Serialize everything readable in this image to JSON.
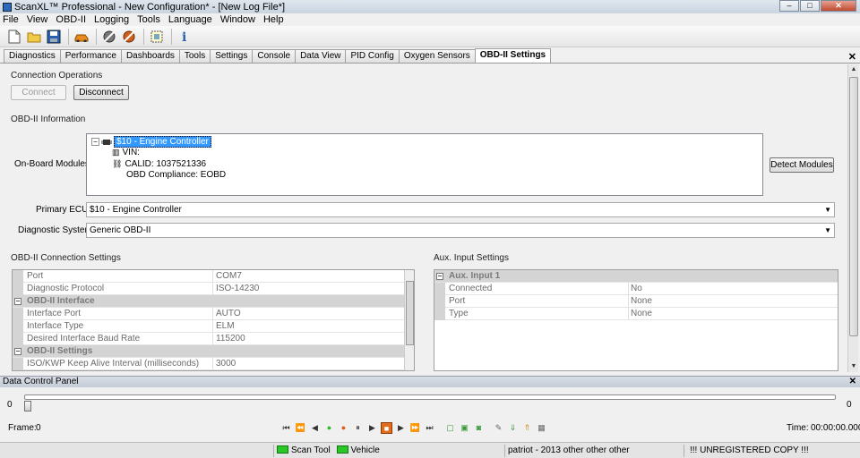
{
  "window": {
    "title": "ScanXL™ Professional - New Configuration* - [New Log File*]",
    "minimize": "–",
    "restore": "□",
    "close": "✕"
  },
  "menu": [
    "File",
    "View",
    "OBD-II",
    "Logging",
    "Tools",
    "Language",
    "Window",
    "Help"
  ],
  "toolbar": {
    "icons": [
      "new-file-icon",
      "open-folder-icon",
      "save-icon",
      "car-icon",
      "connect-icon",
      "disconnect-icon",
      "select-icon",
      "info-icon"
    ]
  },
  "tabs": [
    "Diagnostics",
    "Performance",
    "Dashboards",
    "Tools",
    "Settings",
    "Console",
    "Data View",
    "PID Config",
    "Oxygen Sensors",
    "OBD-II Settings"
  ],
  "active_tab": "OBD-II Settings",
  "connection": {
    "section_label": "Connection Operations",
    "connect_label": "Connect",
    "disconnect_label": "Disconnect"
  },
  "obd_info": {
    "section_label": "OBD-II Information",
    "onboard_label": "On-Board Modules:",
    "tree_root": "$10 - Engine Controller",
    "tree_children": [
      "VIN:",
      "CALID: 1037521336",
      "OBD Compliance: EOBD"
    ],
    "detect_label": "Detect Modules",
    "primary_ecu_label": "Primary ECU:",
    "primary_ecu_value": "$10 - Engine Controller",
    "diag_system_label": "Diagnostic System:",
    "diag_system_value": "Generic OBD-II"
  },
  "conn_settings": {
    "section_label": "OBD-II Connection Settings",
    "rows": [
      {
        "type": "prop",
        "key": "Port",
        "value": "COM7"
      },
      {
        "type": "prop",
        "key": "Diagnostic Protocol",
        "value": "ISO-14230"
      },
      {
        "type": "cat",
        "key": "OBD-II Interface"
      },
      {
        "type": "prop",
        "key": "Interface Port",
        "value": "AUTO"
      },
      {
        "type": "prop",
        "key": "Interface Type",
        "value": "ELM"
      },
      {
        "type": "prop",
        "key": "Desired Interface Baud Rate",
        "value": "115200"
      },
      {
        "type": "cat",
        "key": "OBD-II Settings"
      },
      {
        "type": "prop",
        "key": "ISO/KWP Keep Alive Interval (milliseconds)",
        "value": "3000"
      }
    ]
  },
  "aux_settings": {
    "section_label": "Aux. Input Settings",
    "rows": [
      {
        "type": "cat",
        "key": "Aux. Input 1"
      },
      {
        "type": "prop",
        "key": "Connected",
        "value": "No"
      },
      {
        "type": "prop",
        "key": "Port",
        "value": "None"
      },
      {
        "type": "prop",
        "key": "Type",
        "value": "None"
      }
    ]
  },
  "data_panel": {
    "title": "Data Control Panel",
    "close": "✕",
    "slider_min": "0",
    "slider_max": "0",
    "frame_label": "Frame:",
    "frame_value": "0",
    "time_label": "Time:",
    "time_value": "00:00:00.000"
  },
  "status": {
    "scan_tool": "Scan Tool",
    "vehicle": "Vehicle",
    "vehicle_name": "patriot - 2013 other other other",
    "registration": "!!! UNREGISTERED COPY !!!"
  },
  "colors": {
    "led_green": "#29c529",
    "selection": "#3399ff"
  }
}
